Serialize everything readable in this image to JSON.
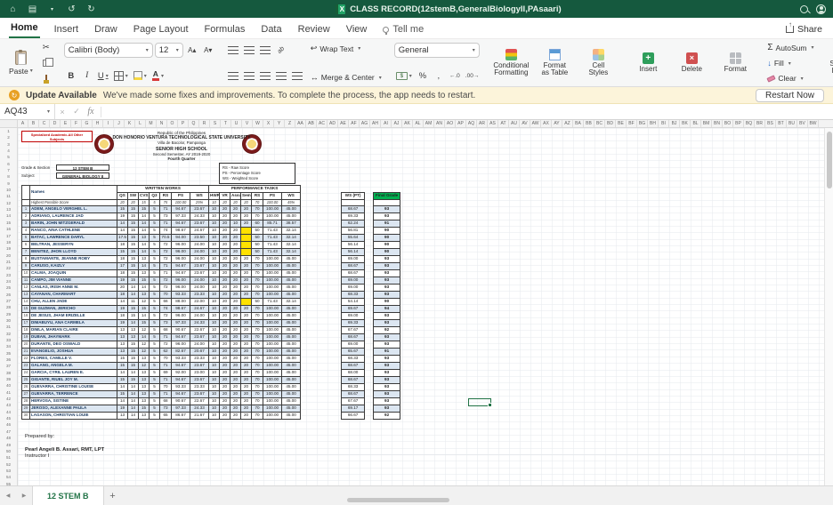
{
  "title_bar": {
    "title": "CLASS RECORD(12stemB,GeneralBiologyII,PAsaari)"
  },
  "ribbon_tabs": [
    {
      "label": "Home",
      "active": true
    },
    {
      "label": "Insert"
    },
    {
      "label": "Draw"
    },
    {
      "label": "Page Layout"
    },
    {
      "label": "Formulas"
    },
    {
      "label": "Data"
    },
    {
      "label": "Review"
    },
    {
      "label": "View"
    }
  ],
  "tell_me_label": "Tell me",
  "share_label": "Share",
  "ribbon": {
    "paste_label": "Paste",
    "font_name": "Calibri (Body)",
    "font_size": "12",
    "bold": "B",
    "italic": "I",
    "underline": "U",
    "wrap_text_label": "Wrap Text",
    "merge_center_label": "Merge & Center",
    "number_format": "General",
    "percent": "%",
    "comma": ",",
    "conditional_formatting_label": "Conditional\nFormatting",
    "format_as_table_label": "Format\nas Table",
    "cell_styles_label": "Cell\nStyles",
    "insert_label": "Insert",
    "delete_label": "Delete",
    "format_label": "Format",
    "autosum_label": "AutoSum",
    "fill_label": "Fill",
    "clear_label": "Clear",
    "sort_filter_label": "Sort &\nFilter",
    "find_select_label": "Find &\nSelect"
  },
  "update_bar": {
    "title": "Update Available",
    "message": "We've made some fixes and improvements. To complete the process, the app needs to restart.",
    "button": "Restart Now"
  },
  "formula_bar": {
    "name_box": "AQ43",
    "fx_label": "fx"
  },
  "sheet": {
    "column_letters": [
      "A",
      "B",
      "C",
      "D",
      "E",
      "F",
      "G",
      "H",
      "I",
      "J",
      "K",
      "L",
      "M",
      "N",
      "O",
      "P",
      "Q",
      "R",
      "S",
      "T",
      "U",
      "V",
      "W",
      "X",
      "Y",
      "Z",
      "AA",
      "AB",
      "AC",
      "AD",
      "AE",
      "AF",
      "AG",
      "AH",
      "AI",
      "AJ",
      "AK",
      "AL",
      "AM",
      "AN",
      "AO",
      "AP",
      "AQ",
      "AR",
      "AS",
      "AT",
      "AU",
      "AV",
      "AW",
      "AX",
      "AY",
      "AZ",
      "BA",
      "BB",
      "BC",
      "BD",
      "BE",
      "BF",
      "BG",
      "BH",
      "BI",
      "BJ",
      "BK",
      "BL",
      "BM",
      "BN",
      "BO",
      "BP",
      "BQ",
      "BR",
      "BS",
      "BT",
      "BU",
      "BV",
      "BW"
    ],
    "row_numbers": [
      1,
      2,
      3,
      4,
      5,
      6,
      7,
      8,
      9,
      10,
      11,
      12,
      13,
      14,
      15,
      16,
      17,
      18,
      19,
      20,
      21,
      22,
      23,
      24,
      25,
      26,
      27,
      28,
      29,
      30,
      31,
      32,
      33,
      34,
      35,
      36,
      37,
      38,
      39,
      40,
      41,
      42,
      43,
      44,
      45,
      46,
      47,
      48,
      49,
      50,
      51,
      52,
      53,
      54,
      55
    ],
    "header_box": "Specialized Academic-All Other Subjects",
    "school_header": {
      "line1": "Republic of the Philippines",
      "line2": "DON HONORIO VENTURA TECHNOLOGICAL STATE UNIVERSITY",
      "line3": "Villa de Bacolor, Pampanga",
      "line4": "SENIOR HIGH SCHOOL",
      "line5": "Second Semester, AY 2019-2020",
      "line6": "Fourth Quarter"
    },
    "meta": {
      "grade_section_label": "Grade & Section",
      "grade_section_value": "12 STEM B",
      "subject_label": "Subject",
      "subject_value": "GENERAL BIOLOGY II",
      "legend": [
        "RS - Raw Score",
        "PS - Percentage Score",
        "WS - Weighted Score"
      ]
    },
    "table": {
      "names_header": "Names",
      "group_ww": "WRITTEN WORKS",
      "group_pt": "PERFORMANCE TASKS",
      "ww_cols": [
        "QS",
        "SW",
        "CVS",
        "Q3",
        "RS",
        "PS",
        "WS"
      ],
      "pt_cols": [
        "HWRT",
        "VR",
        "Assur",
        "Seminar",
        "RS",
        "PS",
        "WS"
      ],
      "ws_pt_header": "WS (PT)",
      "final_header": "Final Grade",
      "hps_label": "Highest Possible Score",
      "hps": {
        "ww": [
          "20",
          "20",
          "15",
          "5"
        ],
        "wrs": "75",
        "wps": "100.00",
        "wws": "25%",
        "pt": [
          "10",
          "20",
          "20",
          "20"
        ],
        "prs": "70",
        "pps": "100.00",
        "pws": "45%"
      },
      "students": [
        {
          "n": "1",
          "name": "ADEM, ANGELO VERGHEL L.",
          "ww": [
            "15",
            "15",
            "15",
            "5"
          ],
          "wrs": "71",
          "wps": "94.67",
          "wws": "23.67",
          "pt": [
            "10",
            "20",
            "20",
            "20"
          ],
          "prs": "70",
          "pps": "100.00",
          "pws": "45.00",
          "tot": "68.67",
          "fg": "93",
          "hl": false
        },
        {
          "n": "2",
          "name": "ADRIANO, LAURENCE JAD",
          "ww": [
            "19",
            "15",
            "14",
            "5"
          ],
          "wrs": "73",
          "wps": "97.33",
          "wws": "24.33",
          "pt": [
            "10",
            "20",
            "20",
            "20"
          ],
          "prs": "70",
          "pps": "100.00",
          "pws": "45.00",
          "tot": "69.33",
          "fg": "93",
          "hl": false
        },
        {
          "n": "3",
          "name": "BARIN, JOHN MITZGERALD",
          "ww": [
            "14",
            "15",
            "14",
            "5"
          ],
          "wrs": "71",
          "wps": "94.67",
          "wws": "23.67",
          "pt": [
            "10",
            "20",
            "10",
            "20"
          ],
          "prs": "60",
          "pps": "85.71",
          "pws": "38.57",
          "tot": "62.24",
          "fg": "91",
          "hl": false
        },
        {
          "n": "4",
          "name": "RANCO, AINA CATHLENE",
          "ww": [
            "14",
            "15",
            "14",
            "5"
          ],
          "wrs": "74",
          "wps": "98.67",
          "wws": "24.67",
          "pt": [
            "10",
            "20",
            "20",
            ""
          ],
          "prs": "50",
          "pps": "71.43",
          "pws": "32.14",
          "tot": "56.81",
          "fg": "90",
          "hl": true
        },
        {
          "n": "5",
          "name": "BATAC, LAWRENCE DARYL",
          "ww": [
            "17.5",
            "15",
            "13",
            "5"
          ],
          "wrs": "70.5",
          "wps": "94.00",
          "wws": "23.50",
          "pt": [
            "10",
            "20",
            "20",
            ""
          ],
          "prs": "50",
          "pps": "71.43",
          "pws": "32.14",
          "tot": "55.64",
          "fg": "90",
          "hl": true
        },
        {
          "n": "6",
          "name": "BELTRAN, JESSERYN",
          "ww": [
            "18",
            "15",
            "14",
            "5"
          ],
          "wrs": "72",
          "wps": "96.00",
          "wws": "24.00",
          "pt": [
            "10",
            "20",
            "20",
            ""
          ],
          "prs": "50",
          "pps": "71.43",
          "pws": "32.14",
          "tot": "56.14",
          "fg": "90",
          "hl": true
        },
        {
          "n": "7",
          "name": "BENITEZ, JHON LLOYD",
          "ww": [
            "15",
            "15",
            "14",
            "5"
          ],
          "wrs": "72",
          "wps": "96.00",
          "wws": "24.00",
          "pt": [
            "10",
            "20",
            "20",
            ""
          ],
          "prs": "50",
          "pps": "71.43",
          "pws": "32.14",
          "tot": "56.14",
          "fg": "90",
          "hl": true
        },
        {
          "n": "8",
          "name": "BUSTAMANTE, JEANNE ROBY",
          "ww": [
            "18",
            "15",
            "13",
            "5"
          ],
          "wrs": "72",
          "wps": "96.00",
          "wws": "24.00",
          "pt": [
            "10",
            "20",
            "20",
            "20"
          ],
          "prs": "70",
          "pps": "100.00",
          "pws": "45.00",
          "tot": "69.00",
          "fg": "93",
          "hl": false
        },
        {
          "n": "9",
          "name": "CARUSO, KAIZLY",
          "ww": [
            "17",
            "15",
            "14",
            "5"
          ],
          "wrs": "71",
          "wps": "94.67",
          "wws": "23.67",
          "pt": [
            "10",
            "20",
            "20",
            "20"
          ],
          "prs": "70",
          "pps": "100.00",
          "pws": "45.00",
          "tot": "68.67",
          "fg": "93",
          "hl": false
        },
        {
          "n": "10",
          "name": "CALMA, JOAQUIN",
          "ww": [
            "18",
            "15",
            "13",
            "5"
          ],
          "wrs": "71",
          "wps": "94.67",
          "wws": "23.67",
          "pt": [
            "10",
            "20",
            "20",
            "20"
          ],
          "prs": "70",
          "pps": "100.00",
          "pws": "45.00",
          "tot": "68.67",
          "fg": "93",
          "hl": false
        },
        {
          "n": "11",
          "name": "CAMPO, JIM VIANNE",
          "ww": [
            "19",
            "15",
            "15",
            "5"
          ],
          "wrs": "72",
          "wps": "96.00",
          "wws": "24.00",
          "pt": [
            "10",
            "20",
            "20",
            "20"
          ],
          "prs": "70",
          "pps": "100.00",
          "pws": "45.00",
          "tot": "69.00",
          "fg": "93",
          "hl": false
        },
        {
          "n": "12",
          "name": "CANLAS, IRISH ANNE M.",
          "ww": [
            "20",
            "14",
            "14",
            "5"
          ],
          "wrs": "72",
          "wps": "96.00",
          "wws": "24.00",
          "pt": [
            "10",
            "20",
            "20",
            "20"
          ],
          "prs": "70",
          "pps": "100.00",
          "pws": "45.00",
          "tot": "69.00",
          "fg": "93",
          "hl": false
        },
        {
          "n": "13",
          "name": "CAYANAN, CHARMART",
          "ww": [
            "18",
            "14",
            "13",
            "5"
          ],
          "wrs": "70",
          "wps": "93.33",
          "wws": "23.33",
          "pt": [
            "10",
            "20",
            "20",
            "20"
          ],
          "prs": "70",
          "pps": "100.00",
          "pws": "45.00",
          "tot": "68.33",
          "fg": "93",
          "hl": false
        },
        {
          "n": "14",
          "name": "CHU, ALLEN JADE",
          "ww": [
            "14",
            "11",
            "12",
            "5"
          ],
          "wrs": "66",
          "wps": "88.00",
          "wws": "22.00",
          "pt": [
            "10",
            "20",
            "20",
            ""
          ],
          "prs": "50",
          "pps": "71.43",
          "pws": "32.14",
          "tot": "54.14",
          "fg": "90",
          "hl": true
        },
        {
          "n": "15",
          "name": "DE GUZMAN, JERICHO",
          "ww": [
            "19",
            "15",
            "15",
            "5"
          ],
          "wrs": "74",
          "wps": "98.67",
          "wws": "24.67",
          "pt": [
            "10",
            "20",
            "20",
            "20"
          ],
          "prs": "70",
          "pps": "100.00",
          "pws": "45.00",
          "tot": "69.67",
          "fg": "94",
          "hl": false
        },
        {
          "n": "16",
          "name": "DE JESUS, JHAM ERIZELLE",
          "ww": [
            "18",
            "15",
            "14",
            "5"
          ],
          "wrs": "72",
          "wps": "96.00",
          "wws": "24.00",
          "pt": [
            "10",
            "20",
            "20",
            "20"
          ],
          "prs": "70",
          "pps": "100.00",
          "pws": "45.00",
          "tot": "69.00",
          "fg": "93",
          "hl": false
        },
        {
          "n": "17",
          "name": "DIMABUYU, ANA CARMELA",
          "ww": [
            "19",
            "14",
            "15",
            "5"
          ],
          "wrs": "73",
          "wps": "97.33",
          "wws": "24.33",
          "pt": [
            "10",
            "20",
            "20",
            "20"
          ],
          "prs": "70",
          "pps": "100.00",
          "pws": "45.00",
          "tot": "69.33",
          "fg": "93",
          "hl": false
        },
        {
          "n": "18",
          "name": "DIMLA, MARIAN CLAIRE",
          "ww": [
            "13",
            "13",
            "12",
            "5"
          ],
          "wrs": "68",
          "wps": "90.67",
          "wws": "22.67",
          "pt": [
            "10",
            "20",
            "20",
            "20"
          ],
          "prs": "70",
          "pps": "100.00",
          "pws": "45.00",
          "tot": "67.67",
          "fg": "92",
          "hl": false
        },
        {
          "n": "19",
          "name": "DUBAN, JHAYMARK",
          "ww": [
            "13",
            "13",
            "14",
            "5"
          ],
          "wrs": "71",
          "wps": "94.67",
          "wws": "23.67",
          "pt": [
            "10",
            "20",
            "20",
            "20"
          ],
          "prs": "70",
          "pps": "100.00",
          "pws": "45.00",
          "tot": "68.67",
          "fg": "93",
          "hl": false
        },
        {
          "n": "20",
          "name": "DURANTE, DEO OSWALD",
          "ww": [
            "13",
            "15",
            "12",
            "5"
          ],
          "wrs": "72",
          "wps": "96.00",
          "wws": "24.00",
          "pt": [
            "10",
            "20",
            "20",
            "20"
          ],
          "prs": "70",
          "pps": "100.00",
          "pws": "45.00",
          "tot": "69.00",
          "fg": "93",
          "hl": false
        },
        {
          "n": "21",
          "name": "EVANGELIO, JOSHUA",
          "ww": [
            "13",
            "15",
            "12",
            "5"
          ],
          "wrs": "62",
          "wps": "82.67",
          "wws": "20.67",
          "pt": [
            "10",
            "20",
            "20",
            "20"
          ],
          "prs": "70",
          "pps": "100.00",
          "pws": "45.00",
          "tot": "65.67",
          "fg": "91",
          "hl": false
        },
        {
          "n": "22",
          "name": "FLORES, CAMILLE V.",
          "ww": [
            "15",
            "15",
            "13",
            "5"
          ],
          "wrs": "70",
          "wps": "93.33",
          "wws": "23.33",
          "pt": [
            "10",
            "20",
            "20",
            "20"
          ],
          "prs": "70",
          "pps": "100.00",
          "pws": "45.00",
          "tot": "68.33",
          "fg": "93",
          "hl": false
        },
        {
          "n": "23",
          "name": "GALANG, ANGELA M.",
          "ww": [
            "15",
            "15",
            "12",
            "5"
          ],
          "wrs": "71",
          "wps": "94.67",
          "wws": "23.67",
          "pt": [
            "10",
            "20",
            "20",
            "20"
          ],
          "prs": "70",
          "pps": "100.00",
          "pws": "45.00",
          "tot": "68.67",
          "fg": "93",
          "hl": false
        },
        {
          "n": "24",
          "name": "GARCIA, CYRIL LAUREN E.",
          "ww": [
            "14",
            "14",
            "13",
            "5"
          ],
          "wrs": "69",
          "wps": "92.00",
          "wws": "23.00",
          "pt": [
            "10",
            "20",
            "20",
            "20"
          ],
          "prs": "70",
          "pps": "100.00",
          "pws": "45.00",
          "tot": "68.00",
          "fg": "93",
          "hl": false
        },
        {
          "n": "25",
          "name": "GIGANTE, RIUEL JOY M.",
          "ww": [
            "15",
            "15",
            "13",
            "5"
          ],
          "wrs": "71",
          "wps": "94.67",
          "wws": "23.67",
          "pt": [
            "10",
            "20",
            "20",
            "20"
          ],
          "prs": "70",
          "pps": "100.00",
          "pws": "45.00",
          "tot": "68.67",
          "fg": "93",
          "hl": false
        },
        {
          "n": "26",
          "name": "GUEVARRA, CHRISTINE LOUISE",
          "ww": [
            "14",
            "14",
            "13",
            "5"
          ],
          "wrs": "70",
          "wps": "93.33",
          "wws": "23.33",
          "pt": [
            "10",
            "20",
            "20",
            "20"
          ],
          "prs": "70",
          "pps": "100.00",
          "pws": "45.00",
          "tot": "68.33",
          "fg": "93",
          "hl": false
        },
        {
          "n": "27",
          "name": "GUEVARRA, TERRENCE",
          "ww": [
            "15",
            "14",
            "13",
            "5"
          ],
          "wrs": "71",
          "wps": "94.67",
          "wws": "23.67",
          "pt": [
            "10",
            "20",
            "20",
            "20"
          ],
          "prs": "70",
          "pps": "100.00",
          "pws": "45.00",
          "tot": "68.67",
          "fg": "93",
          "hl": false
        },
        {
          "n": "28",
          "name": "HERVOSA, SISTINE",
          "ww": [
            "14",
            "14",
            "13",
            "5"
          ],
          "wrs": "68",
          "wps": "90.67",
          "wws": "22.67",
          "pt": [
            "10",
            "20",
            "20",
            "20"
          ],
          "prs": "70",
          "pps": "100.00",
          "pws": "45.00",
          "tot": "67.67",
          "fg": "93",
          "hl": false
        },
        {
          "n": "29",
          "name": "JEROSO, ALEXANNE PAULA",
          "ww": [
            "19",
            "14",
            "15",
            "5"
          ],
          "wrs": "73",
          "wps": "97.33",
          "wws": "24.33",
          "pt": [
            "10",
            "20",
            "20",
            "20"
          ],
          "prs": "70",
          "pps": "100.00",
          "pws": "45.00",
          "tot": "69.17",
          "fg": "93",
          "hl": false
        },
        {
          "n": "30",
          "name": "LAGASON, CHRISTIAN LOUIE",
          "ww": [
            "13",
            "14",
            "13",
            "5"
          ],
          "wrs": "65",
          "wps": "86.67",
          "wws": "21.67",
          "pt": [
            "10",
            "20",
            "20",
            "20"
          ],
          "prs": "70",
          "pps": "100.00",
          "pws": "45.00",
          "tot": "66.67",
          "fg": "92",
          "hl": false
        }
      ]
    },
    "footer": {
      "prepared_by": "Prepared by:",
      "name": "Pearl Angeli B. Assari, RMT, LPT",
      "position": "Instructor I"
    },
    "selected_cell": "AQ43"
  },
  "tab_bar": {
    "sheet_tab": "12 STEM B",
    "add_label": "+"
  }
}
